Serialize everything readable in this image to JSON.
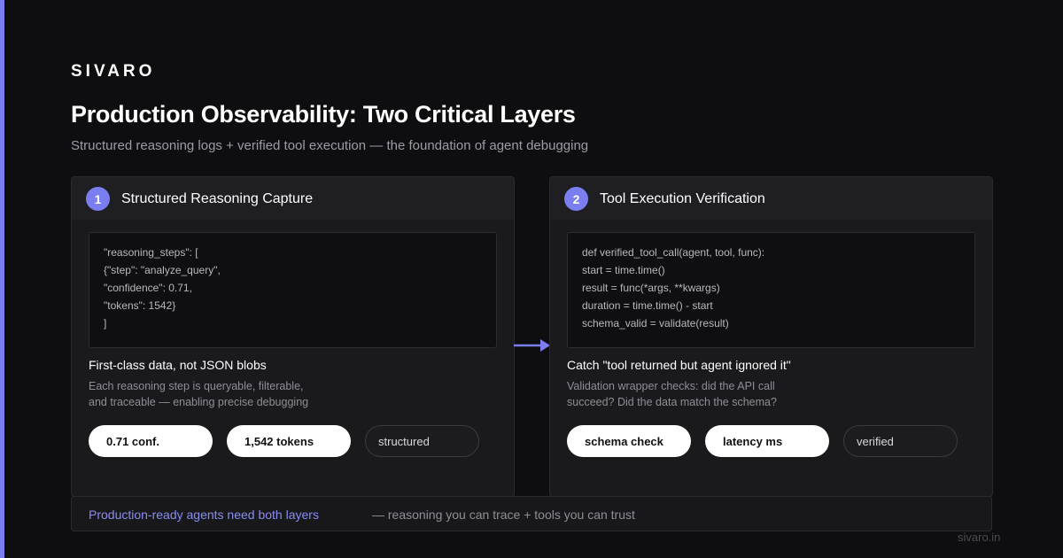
{
  "brand": "SIVARO",
  "title": "Production Observability: Two Critical Layers",
  "subtitle": "Structured reasoning logs + verified tool execution — the foundation of agent debugging",
  "colors": {
    "accent": "#7b7ef0",
    "background": "#0e0e10",
    "card": "#1a1a1d"
  },
  "cards": [
    {
      "number": "1",
      "title": "Structured Reasoning Capture",
      "code": [
        "\"reasoning_steps\": [",
        "{\"step\": \"analyze_query\",",
        "\"confidence\": 0.71,",
        "\"tokens\": 1542}",
        "]"
      ],
      "heading": "First-class data, not JSON blobs",
      "desc": [
        "Each reasoning step is queryable, filterable,",
        "and traceable — enabling precise debugging"
      ],
      "pills": [
        "0.71 conf.",
        "1,542 tokens",
        "structured"
      ]
    },
    {
      "number": "2",
      "title": "Tool Execution Verification",
      "code": [
        "def verified_tool_call(agent, tool, func):",
        "start = time.time()",
        "result = func(*args, **kwargs)",
        "duration = time.time() - start",
        "schema_valid = validate(result)"
      ],
      "heading": "Catch \"tool returned but agent ignored it\"",
      "desc": [
        "Validation wrapper checks: did the API call",
        "succeed? Did the data match the schema?"
      ],
      "pills": [
        "schema check",
        "latency ms",
        "verified"
      ]
    }
  ],
  "footer": {
    "highlight": "Production-ready agents need both layers",
    "rest": "— reasoning you can trace + tools you can trust"
  },
  "domain": "sivaro.in",
  "icons": {
    "connector": "arrow-right-icon"
  }
}
